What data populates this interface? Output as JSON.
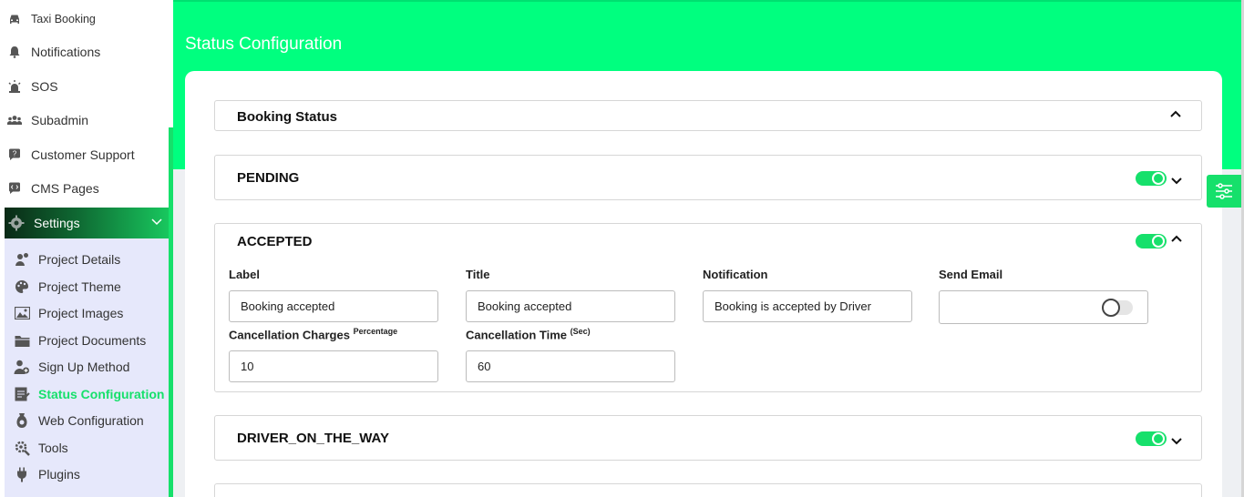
{
  "sidebar": {
    "items": [
      {
        "label": "Taxi Booking",
        "icon": "car-icon"
      },
      {
        "label": "Notifications",
        "icon": "bell-icon"
      },
      {
        "label": "SOS",
        "icon": "siren-icon"
      },
      {
        "label": "Subadmin",
        "icon": "users-icon"
      },
      {
        "label": "Customer Support",
        "icon": "support-chat-icon"
      },
      {
        "label": "CMS Pages",
        "icon": "code-chat-icon"
      }
    ],
    "settings": {
      "label": "Settings",
      "icon": "gear-icon"
    },
    "submenu": [
      {
        "label": "Project Details",
        "icon": "project-details-icon"
      },
      {
        "label": "Project Theme",
        "icon": "palette-icon"
      },
      {
        "label": "Project Images",
        "icon": "image-icon"
      },
      {
        "label": "Project Documents",
        "icon": "folder-icon"
      },
      {
        "label": "Sign Up Method",
        "icon": "user-add-icon"
      },
      {
        "label": "Status Configuration",
        "icon": "status-config-icon",
        "active": true
      },
      {
        "label": "Web Configuration",
        "icon": "web-config-icon"
      },
      {
        "label": "Tools",
        "icon": "tools-icon"
      },
      {
        "label": "Plugins",
        "icon": "plug-icon"
      }
    ]
  },
  "page": {
    "title": "Status Configuration"
  },
  "booking_status": {
    "title": "Booking Status"
  },
  "statuses": {
    "pending": {
      "title": "PENDING",
      "enabled": true,
      "expanded": false
    },
    "accepted": {
      "title": "ACCEPTED",
      "enabled": true,
      "expanded": true,
      "fields": {
        "label": {
          "label": "Label",
          "value": "Booking accepted"
        },
        "title": {
          "label": "Title",
          "value": "Booking accepted"
        },
        "notification": {
          "label": "Notification",
          "value": "Booking is accepted by Driver"
        },
        "send_email": {
          "label": "Send Email",
          "enabled": false
        },
        "cancellation_charges": {
          "label": "Cancellation Charges",
          "sup": "Percentage",
          "value": "10"
        },
        "cancellation_time": {
          "label": "Cancellation Time",
          "sup": "(Sec)",
          "value": "60"
        }
      }
    },
    "driver_on_the_way": {
      "title": "DRIVER_ON_THE_WAY",
      "enabled": true,
      "expanded": false
    }
  },
  "colors": {
    "accent": "#16e06b",
    "header": "#00ff7f",
    "submenu_bg": "#e6e8fb"
  }
}
